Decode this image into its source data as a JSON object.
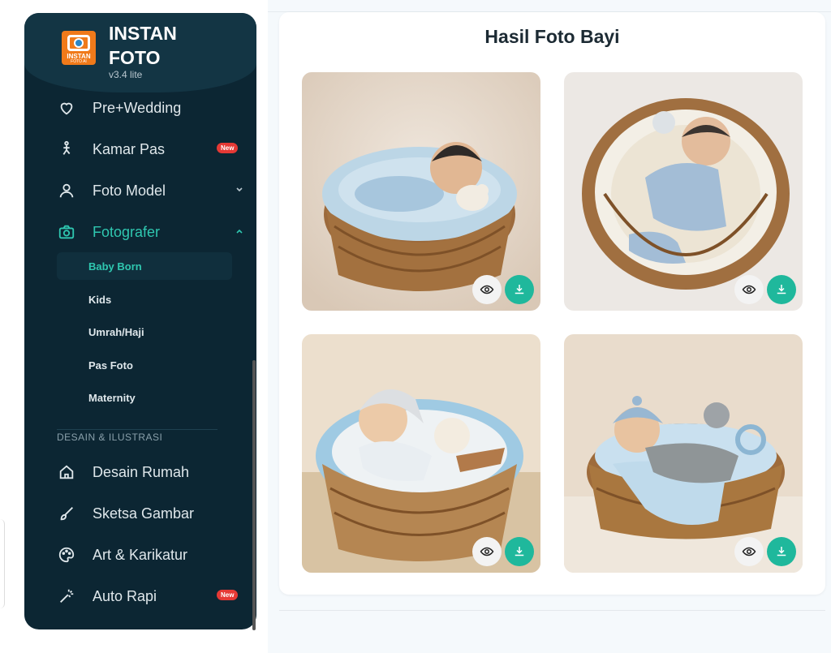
{
  "app": {
    "brand_line1": "INSTAN",
    "brand_line2": "FOTO",
    "version": "v3.4 lite",
    "logo_text": "INSTAN",
    "logo_sub": "FOTO AI"
  },
  "sidebar": {
    "items": [
      {
        "label": "Pre+Wedding",
        "icon": "heart-icon"
      },
      {
        "label": "Kamar Pas",
        "icon": "person-icon",
        "badge": "New"
      },
      {
        "label": "Foto Model",
        "icon": "user-icon"
      },
      {
        "label": "Fotografer",
        "icon": "camera-icon"
      }
    ],
    "sub_items": [
      "Baby Born",
      "Kids",
      "Umrah/Haji",
      "Pas Foto",
      "Maternity"
    ],
    "section_label": "DESAIN & ILUSTRASI",
    "design_items": [
      {
        "label": "Desain Rumah",
        "icon": "home-icon"
      },
      {
        "label": "Sketsa Gambar",
        "icon": "brush-icon"
      },
      {
        "label": "Art & Karikatur",
        "icon": "palette-icon"
      },
      {
        "label": "Auto Rapi",
        "icon": "magic-wand-icon",
        "badge": "New"
      }
    ]
  },
  "main": {
    "title": "Hasil Foto Bayi"
  },
  "colors": {
    "sidebar_bg": "#0c2633",
    "accent": "#2fc7b0",
    "download_btn": "#1fb89c",
    "badge": "#e53935"
  }
}
